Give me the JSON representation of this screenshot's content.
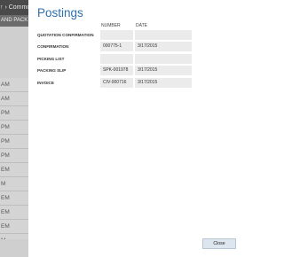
{
  "background": {
    "topbar_text": "↑ › Common",
    "subheader_text": "AND PACK",
    "rows": [
      "AM",
      "AM",
      "PM",
      "PM",
      "PM",
      "PM",
      "EM",
      "M",
      "EM",
      "EM",
      "EM",
      "M",
      "EM"
    ],
    "selected_row_index": 12
  },
  "dialog": {
    "title": "Postings",
    "columns": {
      "number": "NUMBER",
      "date": "DATE"
    },
    "rows": [
      {
        "label": "QUOTATION CONFIRMATION",
        "number": "",
        "date": ""
      },
      {
        "label": "CONFIRMATION",
        "number": "000775-1",
        "date": "3/17/2015"
      },
      {
        "label": "PICKING LIST",
        "number": "",
        "date": ""
      },
      {
        "label": "PACKING SLIP",
        "number": "SPK-001978",
        "date": "3/17/2015"
      },
      {
        "label": "INVOICE",
        "number": "CIV-000716",
        "date": "3/17/2015"
      }
    ],
    "close_label": "Close"
  },
  "colors": {
    "title": "#2e6fae",
    "cell_background": "#ebebeb",
    "button_background": "#dde5ee",
    "sidebar_selected": "#9aa6b4"
  }
}
